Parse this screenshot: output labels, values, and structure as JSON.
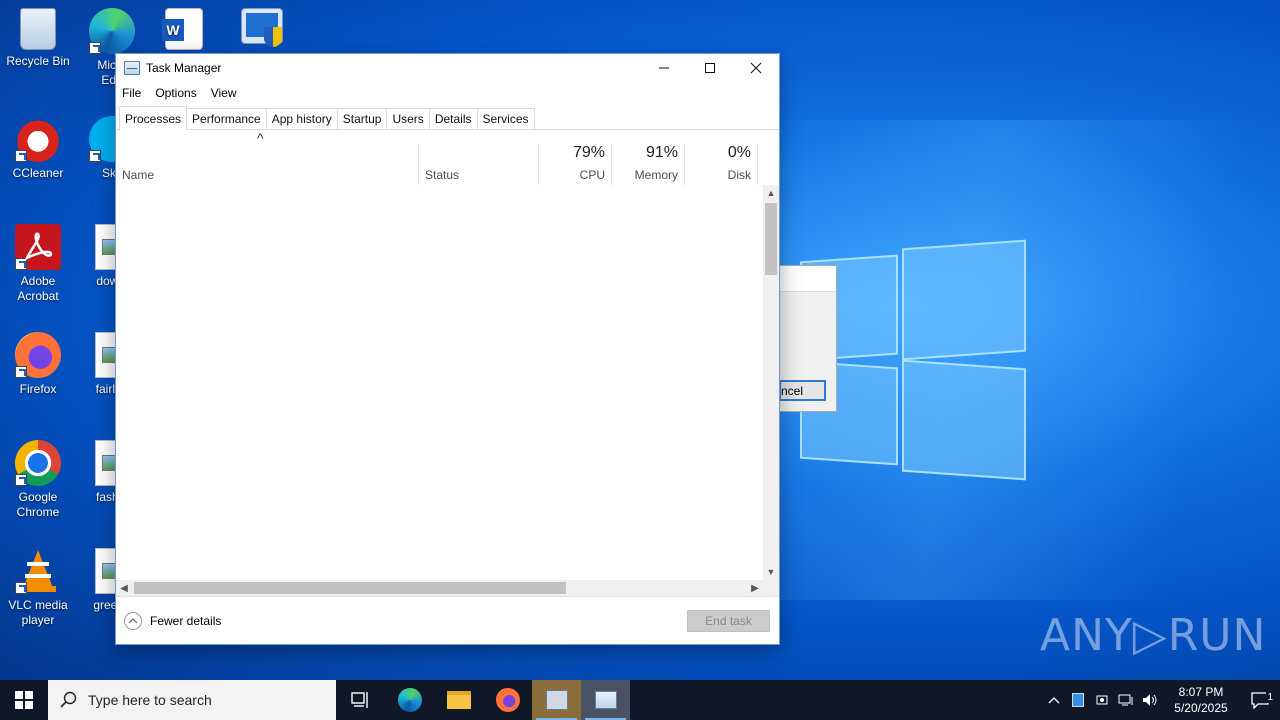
{
  "desktop": {
    "icons": [
      {
        "label": "Recycle Bin",
        "icon": "recycle-bin-icon"
      },
      {
        "label": "Micro\nEdg",
        "icon": "edge-icon"
      },
      {
        "label": "",
        "icon": "word-icon"
      },
      {
        "label": "",
        "icon": "shield-app-icon"
      },
      {
        "label": "CCleaner",
        "icon": "ccleaner-icon"
      },
      {
        "label": "Sky",
        "icon": "skype-icon"
      },
      {
        "label": "Adobe\nAcrobat",
        "icon": "acrobat-icon"
      },
      {
        "label": "downl",
        "icon": "image-file-icon"
      },
      {
        "label": "Firefox",
        "icon": "firefox-icon"
      },
      {
        "label": "fairlea",
        "icon": "image-file-icon"
      },
      {
        "label": "Google\nChrome",
        "icon": "chrome-icon"
      },
      {
        "label": "fashio",
        "icon": "image-file-icon"
      },
      {
        "label": "VLC media\nplayer",
        "icon": "vlc-icon"
      },
      {
        "label": "greenp",
        "icon": "image-file-icon"
      }
    ]
  },
  "task_manager": {
    "title": "Task Manager",
    "menu": [
      "File",
      "Options",
      "View"
    ],
    "tabs": [
      "Processes",
      "Performance",
      "App history",
      "Startup",
      "Users",
      "Details",
      "Services"
    ],
    "active_tab": "Processes",
    "columns": {
      "name": "Name",
      "status": "Status",
      "cpu": {
        "label": "CPU",
        "value": "79%"
      },
      "memory": {
        "label": "Memory",
        "value": "91%"
      },
      "disk": {
        "label": "Disk",
        "value": "0%"
      }
    },
    "fewer_details": "Fewer details",
    "end_task": "End task"
  },
  "background_dialog": {
    "button_fragment": "ncel"
  },
  "watermark": "ANY▷RUN",
  "taskbar": {
    "search_placeholder": "Type here to search",
    "time": "8:07 PM",
    "date": "5/20/2025",
    "notification_count": "1"
  }
}
